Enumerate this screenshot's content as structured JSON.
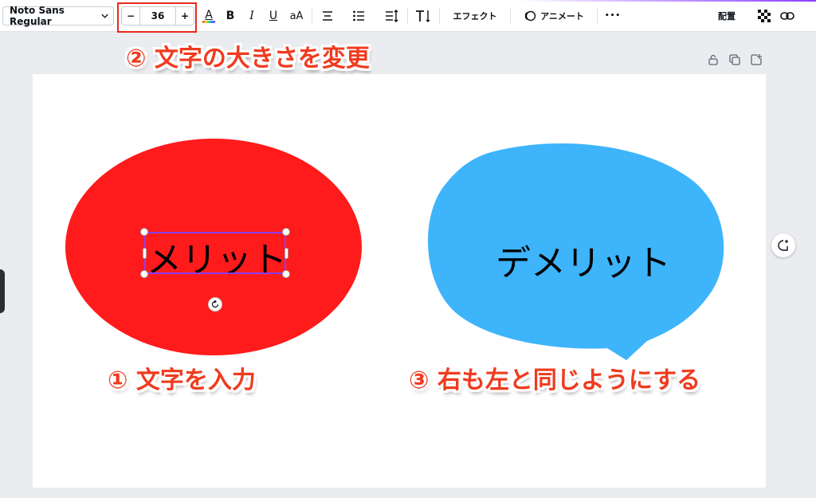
{
  "toolbar": {
    "font_family": "Noto Sans Regular",
    "font_size": "36",
    "decrease_label": "−",
    "increase_label": "+",
    "text_color_label": "A",
    "bold_label": "B",
    "italic_label": "I",
    "underline_label": "U",
    "case_label": "aA",
    "effects_label": "エフェクト",
    "animate_label": "アニメート",
    "more_label": "•••",
    "position_label": "配置"
  },
  "annotations": {
    "step2": "② 文字の大きさを変更",
    "step1": "① 文字を入力",
    "step3": "③ 右も左と同じようにする"
  },
  "canvas": {
    "left_shape_text": "メリット",
    "right_shape_text": "デメリット"
  },
  "colors": {
    "red_shape": "#ff1b1b",
    "blue_shape": "#3eb4fb",
    "selection": "#8b3dff",
    "annotation": "#ef3b1f",
    "highlight": "#e8291c"
  },
  "icons": {
    "chevron": "chevron-down-icon",
    "align": "align-center-icon",
    "list": "bullet-list-icon",
    "spacing": "line-spacing-icon",
    "vertical": "vertical-text-icon",
    "animate": "animate-icon",
    "transparency": "transparency-icon",
    "link": "link-icon",
    "lock": "lock-icon",
    "duplicate": "duplicate-icon",
    "add_page": "add-page-icon",
    "rotate": "rotate-icon",
    "comment": "add-comment-icon"
  }
}
